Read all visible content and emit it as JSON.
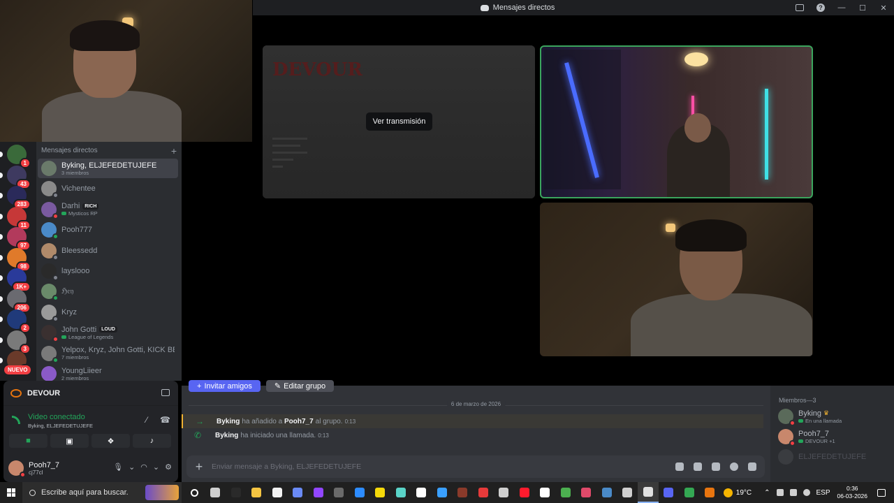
{
  "window": {
    "title": "Mensajes directos"
  },
  "stage": {
    "watch_stream_label": "Ver transmisión",
    "stream_app_logo": "DEVOUR"
  },
  "servers": [
    {
      "badge": "1",
      "color": "#3a6a3a"
    },
    {
      "badge": "43",
      "color": "#3e3a60"
    },
    {
      "badge": "283",
      "color": "#2a2a5a"
    },
    {
      "badge": "11",
      "color": "#c63838"
    },
    {
      "badge": "97",
      "color": "#b23a5c"
    },
    {
      "badge": "98",
      "color": "#e07a2a"
    },
    {
      "badge": "1K+",
      "color": "#2a3a9a"
    },
    {
      "badge": "206",
      "color": "#6a6a70"
    },
    {
      "badge": "2",
      "color": "#203a7a"
    },
    {
      "badge": "3",
      "color": "#7a7a7a"
    },
    {
      "badge": "4",
      "color": "#6a3a2a"
    }
  ],
  "servers_new_label": "NUEVO",
  "dm_list": {
    "header": "Mensajes directos",
    "items": [
      {
        "name": "Byking, ELJEFEDETUJEFE",
        "sub": "3 miembros",
        "color": "#6a7a6a",
        "status": "none",
        "active": true
      },
      {
        "name": "Vichentee",
        "sub": "",
        "color": "#8a8a8a",
        "status": "offline"
      },
      {
        "name": "Darhi",
        "tag": "RICH",
        "sub": "Mysticos RP",
        "sub_game": true,
        "color": "#7a5aa0",
        "status": "dnd"
      },
      {
        "name": "Pooh777",
        "sub": "",
        "color": "#4a8ac8",
        "status": "online"
      },
      {
        "name": "Bleessedd",
        "sub": "",
        "color": "#b08a6a",
        "status": "offline"
      },
      {
        "name": "layslooo",
        "sub": "",
        "color": "#2a2a2a",
        "status": "offline"
      },
      {
        "name": "ℌ𝔢𝔶",
        "sub": "",
        "color": "#6a8a6a",
        "status": "online"
      },
      {
        "name": "Kryz",
        "sub": "",
        "color": "#9a9a9a",
        "status": "offline"
      },
      {
        "name": "John Gotti",
        "tag": "LOUD",
        "sub": "League of Legends",
        "sub_game": true,
        "color": "#3a3030",
        "status": "dnd"
      },
      {
        "name": "Yelpox, Kryz, John Gotti, KICK BE...",
        "sub": "7 miembros",
        "color": "#7a7a7a",
        "status": "online"
      },
      {
        "name": "YoungLiieer",
        "sub": "2 miembros",
        "color": "#8a5ac8",
        "status": "none"
      }
    ]
  },
  "voice_panel": {
    "activity_name": "DEVOUR",
    "connection_label": "Video conectado",
    "channel": "Byking, ELJEFEDETUJEFE",
    "user_name": "Pooh7_7",
    "user_handle": "cj77cl"
  },
  "chat": {
    "invite_button": "Invitar amigos",
    "edit_button": "Editar grupo",
    "date": "6 de marzo de 2026",
    "system_messages": [
      {
        "actor": "Byking",
        "text": "ha añadido a",
        "target": "Pooh7_7",
        "tail": "al grupo.",
        "time": "0:13",
        "icon": "→"
      },
      {
        "actor": "Byking",
        "text": "ha iniciado una llamada.",
        "target": "",
        "tail": "",
        "time": "0:13",
        "icon": "✆"
      }
    ],
    "input_placeholder": "Enviar mensaje a Byking, ELJEFEDETUJEFE"
  },
  "members": {
    "header": "Miembros—3",
    "items": [
      {
        "name": "Byking",
        "crown": true,
        "status_text": "En una llamada",
        "color": "#5a6a5a",
        "status": "dnd"
      },
      {
        "name": "Pooh7_7",
        "crown": false,
        "status_text": "DEVOUR +1",
        "color": "#c8876c",
        "status": "dnd"
      },
      {
        "name": "ELJEFEDETUJEFE",
        "crown": false,
        "status_text": "",
        "color": "#3a3c40",
        "status": "offline"
      }
    ]
  },
  "taskbar": {
    "search_placeholder": "Escribe aquí para buscar.",
    "apps": [
      {
        "name": "cortana",
        "color": "#ffffff"
      },
      {
        "name": "task-view",
        "color": "#cfcfcf"
      },
      {
        "name": "app-dark",
        "color": "#2a2a2a"
      },
      {
        "name": "file-explorer",
        "color": "#f5c542"
      },
      {
        "name": "notepad",
        "color": "#f2f2f2"
      },
      {
        "name": "copilot",
        "color": "#6a8af5"
      },
      {
        "name": "twitch",
        "color": "#9146ff"
      },
      {
        "name": "folder-dark",
        "color": "#6a6a6a"
      },
      {
        "name": "zoom",
        "color": "#2d8cff"
      },
      {
        "name": "sticky-notes",
        "color": "#f5d90a"
      },
      {
        "name": "app-teal",
        "color": "#5ad4c8"
      },
      {
        "name": "capcut",
        "color": "#ffffff"
      },
      {
        "name": "app-blue",
        "color": "#3aa0ff"
      },
      {
        "name": "app-red",
        "color": "#8a3a2a"
      },
      {
        "name": "app-mail",
        "color": "#e63a3a"
      },
      {
        "name": "settings",
        "color": "#cfcfcf"
      },
      {
        "name": "opera",
        "color": "#ff1b2d"
      },
      {
        "name": "tiktok",
        "color": "#ffffff"
      },
      {
        "name": "minecraft",
        "color": "#4caf50"
      },
      {
        "name": "app-a",
        "color": "#e04a6a"
      },
      {
        "name": "steam",
        "color": "#4a8ac8"
      },
      {
        "name": "app-c",
        "color": "#cfcfcf"
      },
      {
        "name": "obs",
        "color": "#e0e0e0"
      },
      {
        "name": "discord",
        "color": "#5865f2"
      },
      {
        "name": "chrome",
        "color": "#34a853"
      },
      {
        "name": "devour",
        "color": "#e8750f"
      }
    ],
    "temperature": "19°C",
    "language": "ESP",
    "time": "0:36",
    "date": "06-03-2026"
  }
}
